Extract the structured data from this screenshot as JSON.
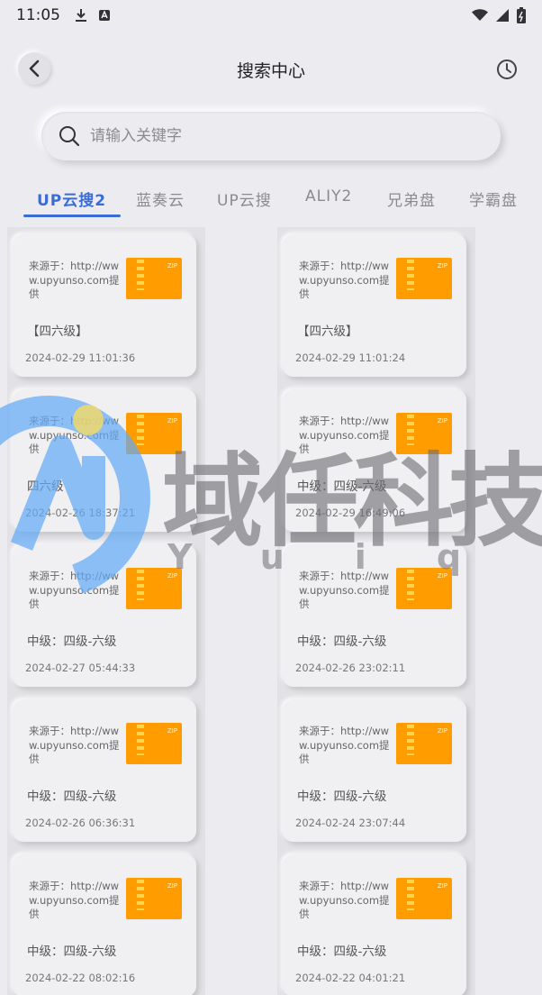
{
  "status_bar": {
    "time": "11:05"
  },
  "header": {
    "title": "搜索中心"
  },
  "search": {
    "placeholder": "请输入关键字"
  },
  "tabs": [
    {
      "label": "UP云搜2",
      "active": true
    },
    {
      "label": "蓝奏云"
    },
    {
      "label": "UP云搜"
    },
    {
      "label": "ALIY2"
    },
    {
      "label": "兄弟盘"
    },
    {
      "label": "学霸盘"
    }
  ],
  "cards": [
    {
      "source": "来源于：http://www.upyunso.com提供",
      "title": "【四六级】",
      "date": "2024-02-29 11:01:36"
    },
    {
      "source": "来源于：http://www.upyunso.com提供",
      "title": "【四六级】",
      "date": "2024-02-29 11:01:24"
    },
    {
      "source": "来源于：http://www.upyunso.com提供",
      "title": "四六级",
      "date": "2024-02-26 18:37:21"
    },
    {
      "source": "来源于：http://www.upyunso.com提供",
      "title": "中级：四级-六级",
      "date": "2024-02-29 16:49:06"
    },
    {
      "source": "来源于：http://www.upyunso.com提供",
      "title": "中级：四级-六级",
      "date": "2024-02-27 05:44:33"
    },
    {
      "source": "来源于：http://www.upyunso.com提供",
      "title": "中级：四级-六级",
      "date": "2024-02-26 23:02:11"
    },
    {
      "source": "来源于：http://www.upyunso.com提供",
      "title": "中级：四级-六级",
      "date": "2024-02-26 06:36:31"
    },
    {
      "source": "来源于：http://www.upyunso.com提供",
      "title": "中级：四级-六级",
      "date": "2024-02-24 23:07:44"
    },
    {
      "source": "来源于：http://www.upyunso.com提供",
      "title": "中级：四级-六级",
      "date": "2024-02-22 08:02:16"
    },
    {
      "source": "来源于：http://www.upyunso.com提供",
      "title": "中级：四级-六级",
      "date": "2024-02-22 04:01:21"
    }
  ],
  "watermark": {
    "text": "域任科技",
    "sub": "Yuiq"
  },
  "icons": {
    "back": "chevron-left-icon",
    "history": "clock-icon",
    "search": "search-icon",
    "thumb": "zip-archive-icon"
  },
  "colors": {
    "accent": "#3a6cd8",
    "thumb": "#ff9c00",
    "background": "#ececf0"
  }
}
